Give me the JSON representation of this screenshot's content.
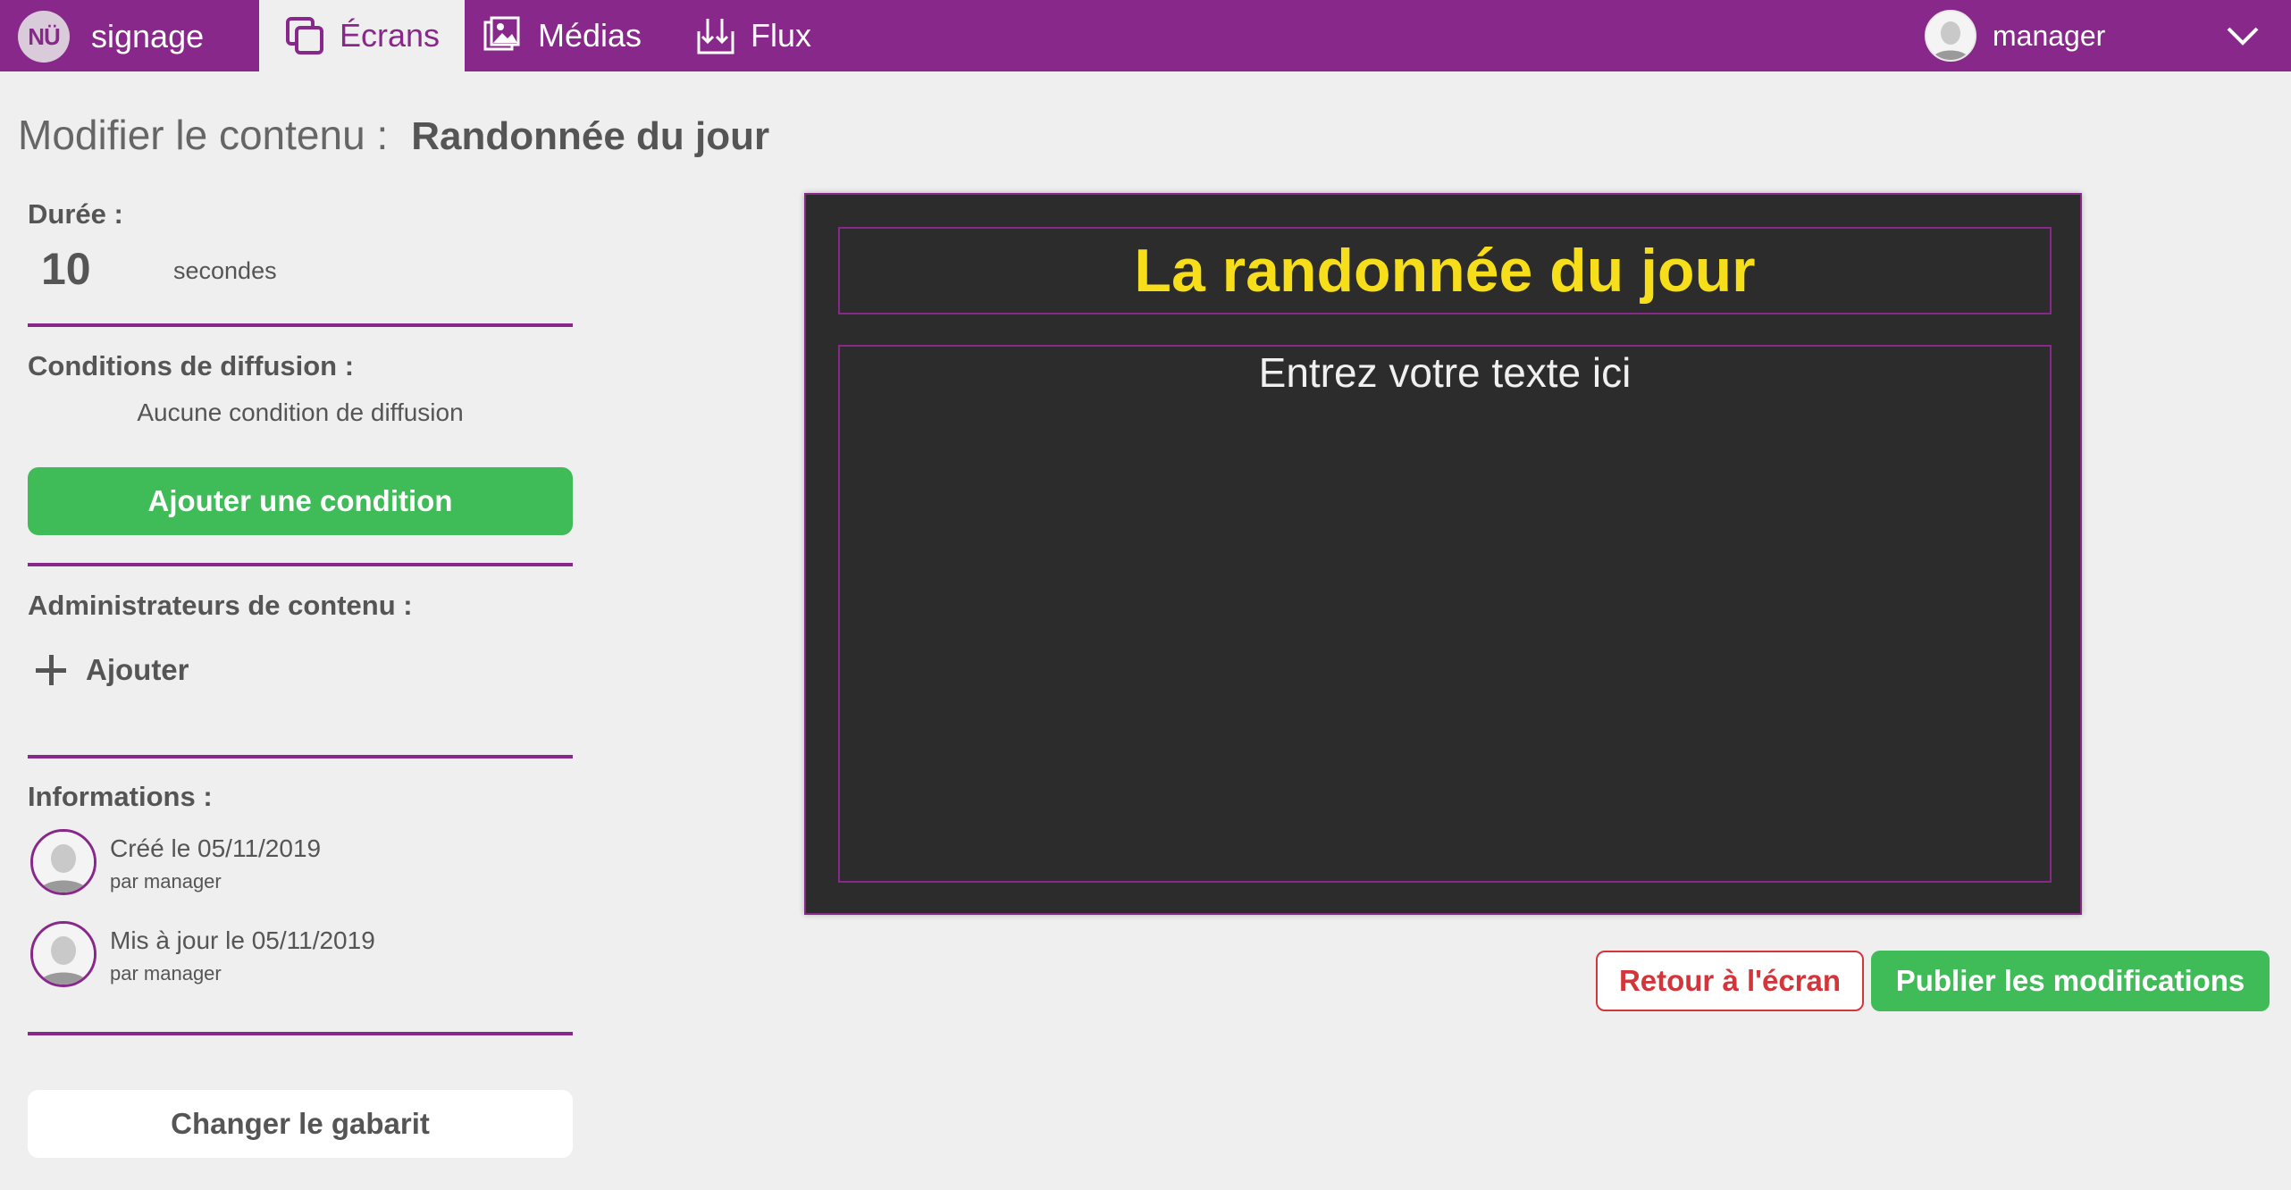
{
  "brand": {
    "logo_text": "NÜ",
    "name": "signage"
  },
  "nav": {
    "tabs": [
      {
        "label": "Écrans",
        "icon": "screens-icon",
        "active": true
      },
      {
        "label": "Médias",
        "icon": "media-icon",
        "active": false
      },
      {
        "label": "Flux",
        "icon": "feed-icon",
        "active": false
      }
    ]
  },
  "user": {
    "name": "manager"
  },
  "page": {
    "title_prefix": "Modifier le contenu :",
    "content_name": "Randonnée du jour"
  },
  "duration": {
    "label": "Durée :",
    "value": "10",
    "unit": "secondes"
  },
  "conditions": {
    "label": "Conditions de diffusion :",
    "empty_text": "Aucune condition de diffusion",
    "add_button": "Ajouter une condition"
  },
  "admins": {
    "label": "Administrateurs de contenu :",
    "add_label": "Ajouter"
  },
  "info": {
    "label": "Informations :",
    "created": {
      "text": "Créé le 05/11/2019",
      "by": "par manager"
    },
    "updated": {
      "text": "Mis à jour le 05/11/2019",
      "by": "par manager"
    }
  },
  "template_button": "Changer le gabarit",
  "preview": {
    "title": "La randonnée du jour",
    "body_placeholder": "Entrez votre texte ici"
  },
  "actions": {
    "back": "Retour à l'écran",
    "publish": "Publier les modifications"
  },
  "colors": {
    "brand_purple": "#88288a",
    "accent_green": "#3fbb57",
    "danger_red": "#d3353a",
    "preview_bg": "#2c2c2c",
    "preview_title": "#f6df1a"
  }
}
